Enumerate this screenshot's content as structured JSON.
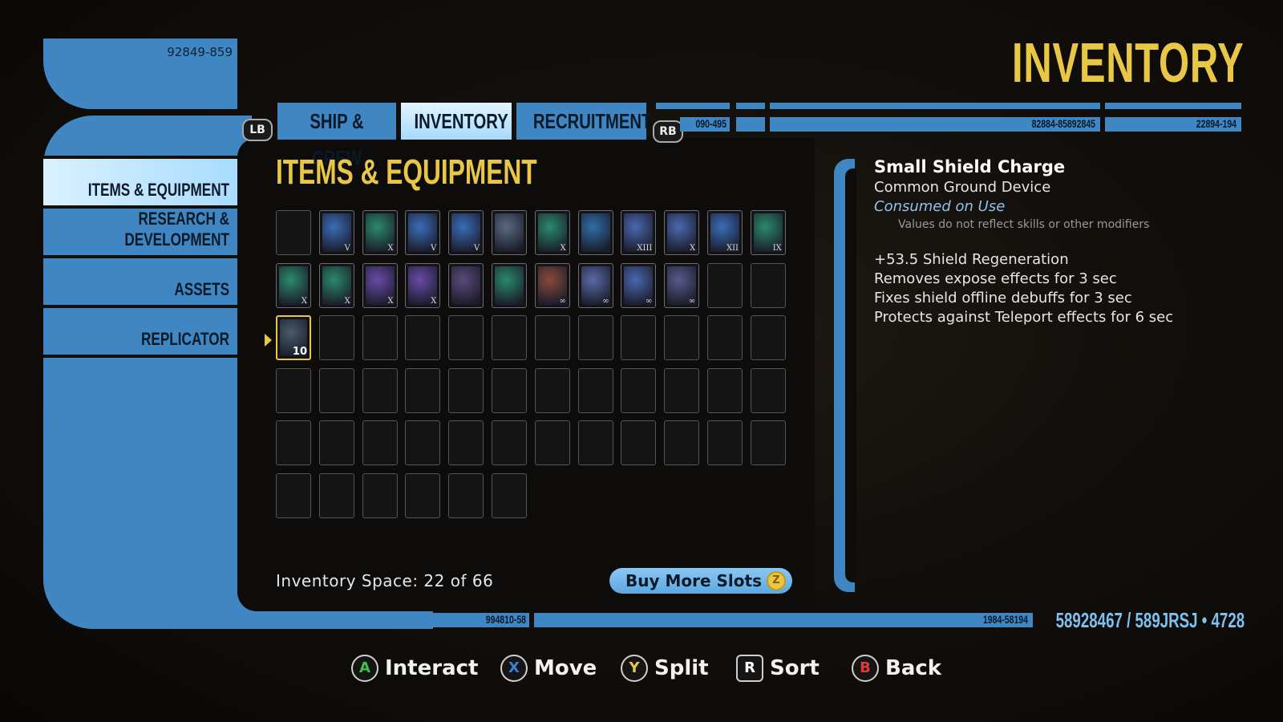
{
  "header": {
    "title": "INVENTORY",
    "code_top_left": "92849-859"
  },
  "tabs": {
    "lb": "LB",
    "rb": "RB",
    "items": [
      "SHIP & CREW",
      "INVENTORY",
      "RECRUITMENT"
    ],
    "active_index": 1
  },
  "strip_codes": {
    "a": "090-495",
    "b": "82884-85892845",
    "c": "22894-194",
    "d": "994810-58",
    "e": "1984-58194"
  },
  "sidebar": {
    "items": [
      {
        "label": "ITEMS & EQUIPMENT",
        "active": true
      },
      {
        "label": "RESEARCH & DEVELOPMENT",
        "active": false
      },
      {
        "label": "ASSETS",
        "active": false
      },
      {
        "label": "REPLICATOR",
        "active": false
      }
    ]
  },
  "main": {
    "section_title": "ITEMS & EQUIPMENT",
    "grid": {
      "columns": 12,
      "rows": [
        [
          {
            "icon": "empty"
          },
          {
            "icon": "blade-item",
            "color": "#3a6db8",
            "mark": "V"
          },
          {
            "icon": "coil-item",
            "color": "#2a8a6a",
            "mark": "X"
          },
          {
            "icon": "blade-item",
            "color": "#3a6db8",
            "mark": "V"
          },
          {
            "icon": "blade-item",
            "color": "#3a6db8",
            "mark": "V"
          },
          {
            "icon": "canister-item",
            "color": "#5a6a82",
            "mark": ""
          },
          {
            "icon": "coil-item",
            "color": "#2a8a6a",
            "mark": "X"
          },
          {
            "icon": "module-item",
            "color": "#2f6fa8",
            "mark": ""
          },
          {
            "icon": "tower-item",
            "color": "#4a68b0",
            "mark": "XIII"
          },
          {
            "icon": "tower-item",
            "color": "#4a68b0",
            "mark": "X"
          },
          {
            "icon": "chevron-item",
            "color": "#3a6db8",
            "mark": "XII"
          },
          {
            "icon": "sphere-item",
            "color": "#2a8a6a",
            "mark": "IX"
          }
        ],
        [
          {
            "icon": "coil-item",
            "color": "#2a8a6a",
            "mark": "X"
          },
          {
            "icon": "coil-item",
            "color": "#2a8a6a",
            "mark": "X"
          },
          {
            "icon": "rifle-item",
            "color": "#6a4aa8",
            "mark": "X"
          },
          {
            "icon": "rifle-item",
            "color": "#6a4aa8",
            "mark": "X"
          },
          {
            "icon": "armor-item",
            "color": "#5a4a7a",
            "mark": ""
          },
          {
            "icon": "pad-item",
            "color": "#2a8a6a",
            "mark": ""
          },
          {
            "icon": "canister-item",
            "color": "#8a4a3a",
            "mark": "∞"
          },
          {
            "icon": "device-item",
            "color": "#5a6aa8",
            "mark": "∞"
          },
          {
            "icon": "device-item",
            "color": "#4a68b0",
            "mark": "∞"
          },
          {
            "icon": "device-item",
            "color": "#5a5a8a",
            "mark": "∞"
          },
          {
            "icon": "empty"
          },
          {
            "icon": "empty"
          }
        ],
        [
          {
            "icon": "shield-charge-item",
            "color": "#4a5a6a",
            "qty": "10",
            "selected": true
          }
        ]
      ],
      "total_slots": 66
    },
    "inventory_space": "Inventory Space: 22 of 66",
    "buy_button": "Buy More Slots",
    "buy_icon": "Z"
  },
  "detail": {
    "name": "Small Shield Charge",
    "type": "Common Ground Device",
    "consumed": "Consumed on Use",
    "note": "Values do not reflect skills or other modifiers",
    "stats": [
      "+53.5 Shield Regeneration",
      "Removes expose effects for 3 sec",
      "Fixes shield offline debuffs for 3 sec",
      "Protects against Teleport effects for 6 sec"
    ]
  },
  "footer": {
    "status": "58928467 / 589JRSJ • 4728",
    "hints": [
      {
        "button": "A",
        "label": "Interact",
        "color": "#3fbf4f"
      },
      {
        "button": "X",
        "label": "Move",
        "color": "#3a7fe0"
      },
      {
        "button": "Y",
        "label": "Split",
        "color": "#e8c746"
      },
      {
        "button": "R",
        "label": "Sort",
        "color": "#ffffff"
      },
      {
        "button": "B",
        "label": "Back",
        "color": "#e03a3a"
      }
    ]
  }
}
